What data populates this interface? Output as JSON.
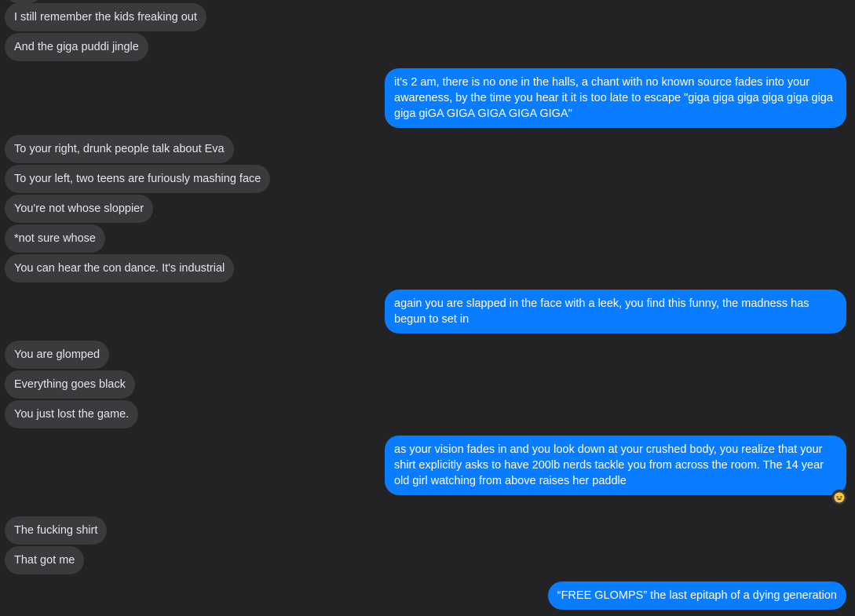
{
  "messages": [
    {
      "from": "them",
      "text": "I still remember the kids freaking out"
    },
    {
      "from": "them",
      "text": "And the giga puddi jingle"
    },
    {
      "from": "me",
      "text": "it's 2 am, there is no one in the halls, a chant with no known source fades into your awareness, by the time you hear it it is too late to escape \"giga giga giga giga giga giga giga giGA GIGA GIGA GIGA GIGA\""
    },
    {
      "from": "them",
      "text": "To your right, drunk people talk about Eva"
    },
    {
      "from": "them",
      "text": "To your left, two teens are furiously mashing face"
    },
    {
      "from": "them",
      "text": "You're not whose sloppier"
    },
    {
      "from": "them",
      "text": "*not sure whose"
    },
    {
      "from": "them",
      "text": "You can hear the con dance. It's industrial"
    },
    {
      "from": "me",
      "text": "again you are slapped in the face with a leek, you find this funny, the madness has begun to set in"
    },
    {
      "from": "them",
      "text": "You are glomped"
    },
    {
      "from": "them",
      "text": "Everything goes black"
    },
    {
      "from": "them",
      "text": "You just lost the game."
    },
    {
      "from": "me",
      "text": "as your vision fades in and you look down at your crushed body, you realize that your shirt explicitly asks to have 200lb nerds tackle you from across the room. The 14 year old girl watching from above raises her paddle",
      "reaction": "laughing-emoji"
    },
    {
      "from": "them",
      "text": "The fucking shirt"
    },
    {
      "from": "them",
      "text": "That got me"
    },
    {
      "from": "me",
      "text": "“FREE GLOMPS” the last epitaph of a dying generation"
    }
  ],
  "colors": {
    "background": "#232325",
    "incoming_bubble": "#3b3b3d",
    "outgoing_bubble": "#0a7cff"
  }
}
